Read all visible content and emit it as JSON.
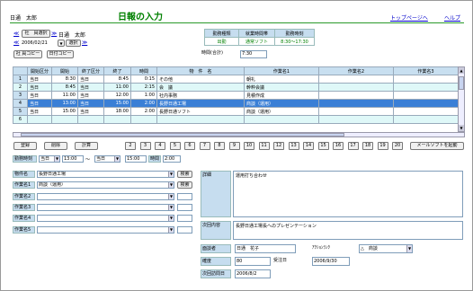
{
  "header": {
    "user": "日通　太郎",
    "title": "日報の入力",
    "top_link": "トップページへ",
    "help_link": "ヘルプ"
  },
  "nav": {
    "prev": "≪",
    "employee_btn": "社　員選択",
    "next": "≫",
    "user_name": "日通　太郎",
    "date_prev": "≪",
    "date": "2006/02/21",
    "date_select": "▼",
    "date_select_btn": "選択",
    "date_next": "≫",
    "copy_employee": "社 員コピー",
    "copy_date": "日付コピー"
  },
  "status_table": {
    "headers": [
      "勤務種類",
      "就業時間帯",
      "勤務時刻"
    ],
    "values": [
      "出勤",
      "通常ソフト",
      "8:30～17:30"
    ]
  },
  "total": {
    "label": "時間(合計)",
    "value": "7:30"
  },
  "grid": {
    "headers": [
      "",
      "開始区分",
      "開始",
      "終了区分",
      "終了",
      "時間",
      "物　件　名",
      "作業名1",
      "作業名2",
      "作業名3"
    ],
    "rows": [
      [
        "1",
        "当日",
        "8:30",
        "当日",
        "8:45",
        "0:15",
        "その他",
        "朝礼",
        "",
        ""
      ],
      [
        "2",
        "当日",
        "8:45",
        "当日",
        "11:00",
        "2:15",
        "会　議",
        "幹粋会議",
        "",
        ""
      ],
      [
        "3",
        "当日",
        "11:00",
        "当日",
        "12:00",
        "1:00",
        "社内事務",
        "見積作成",
        "",
        ""
      ],
      [
        "4",
        "当日",
        "13:00",
        "当日",
        "15:00",
        "2:00",
        "長野日通工場",
        "商談（運用）",
        "",
        ""
      ],
      [
        "5",
        "当日",
        "15:00",
        "当日",
        "18:00",
        "2:00",
        "長野日通ソフト",
        "商談（運用）",
        "",
        ""
      ],
      [
        "6",
        "",
        "",
        "",
        "",
        "",
        "",
        "",
        "",
        ""
      ]
    ]
  },
  "actions": {
    "register": "登録",
    "delete": "削除",
    "calc": "計算",
    "pages": [
      "2",
      "3",
      "4",
      "5",
      "6",
      "7",
      "8",
      "9",
      "10",
      "11",
      "12",
      "13",
      "14",
      "15",
      "16",
      "17",
      "18",
      "19",
      "20"
    ],
    "mail": "メールソフトを起動"
  },
  "time_row": {
    "label": "勤務時刻",
    "start_type": "当日",
    "start": "13:00",
    "sep": "～",
    "end_type": "当日",
    "end": "15:00",
    "hours_label": "時間",
    "hours": "2:00"
  },
  "form": {
    "property_label": "物件名",
    "property_value": "長野日通工場",
    "search": "検索",
    "work1_label": "作業名1",
    "work1_value": "商談（運用）",
    "work2_label": "作業名2",
    "work3_label": "作業名3",
    "work4_label": "作業名4",
    "work5_label": "作業名5"
  },
  "detail": {
    "label": "詳細",
    "value": "運用打ち合わせ"
  },
  "next_plan": {
    "label": "次回内容",
    "value": "長野日通工場長へのプレゼンテーション"
  },
  "contact": {
    "label": "面談者",
    "value": "日通　花子",
    "action_label": "ｱｸｼｮﾝﾗﾝｸ",
    "action_value": "△　商談"
  },
  "prob": {
    "label": "確度",
    "value": "80",
    "order_date_label": "受注日",
    "order_date": "2006/9/30"
  },
  "next_visit": {
    "label": "次回訪問日",
    "value": "2006/8/2"
  }
}
